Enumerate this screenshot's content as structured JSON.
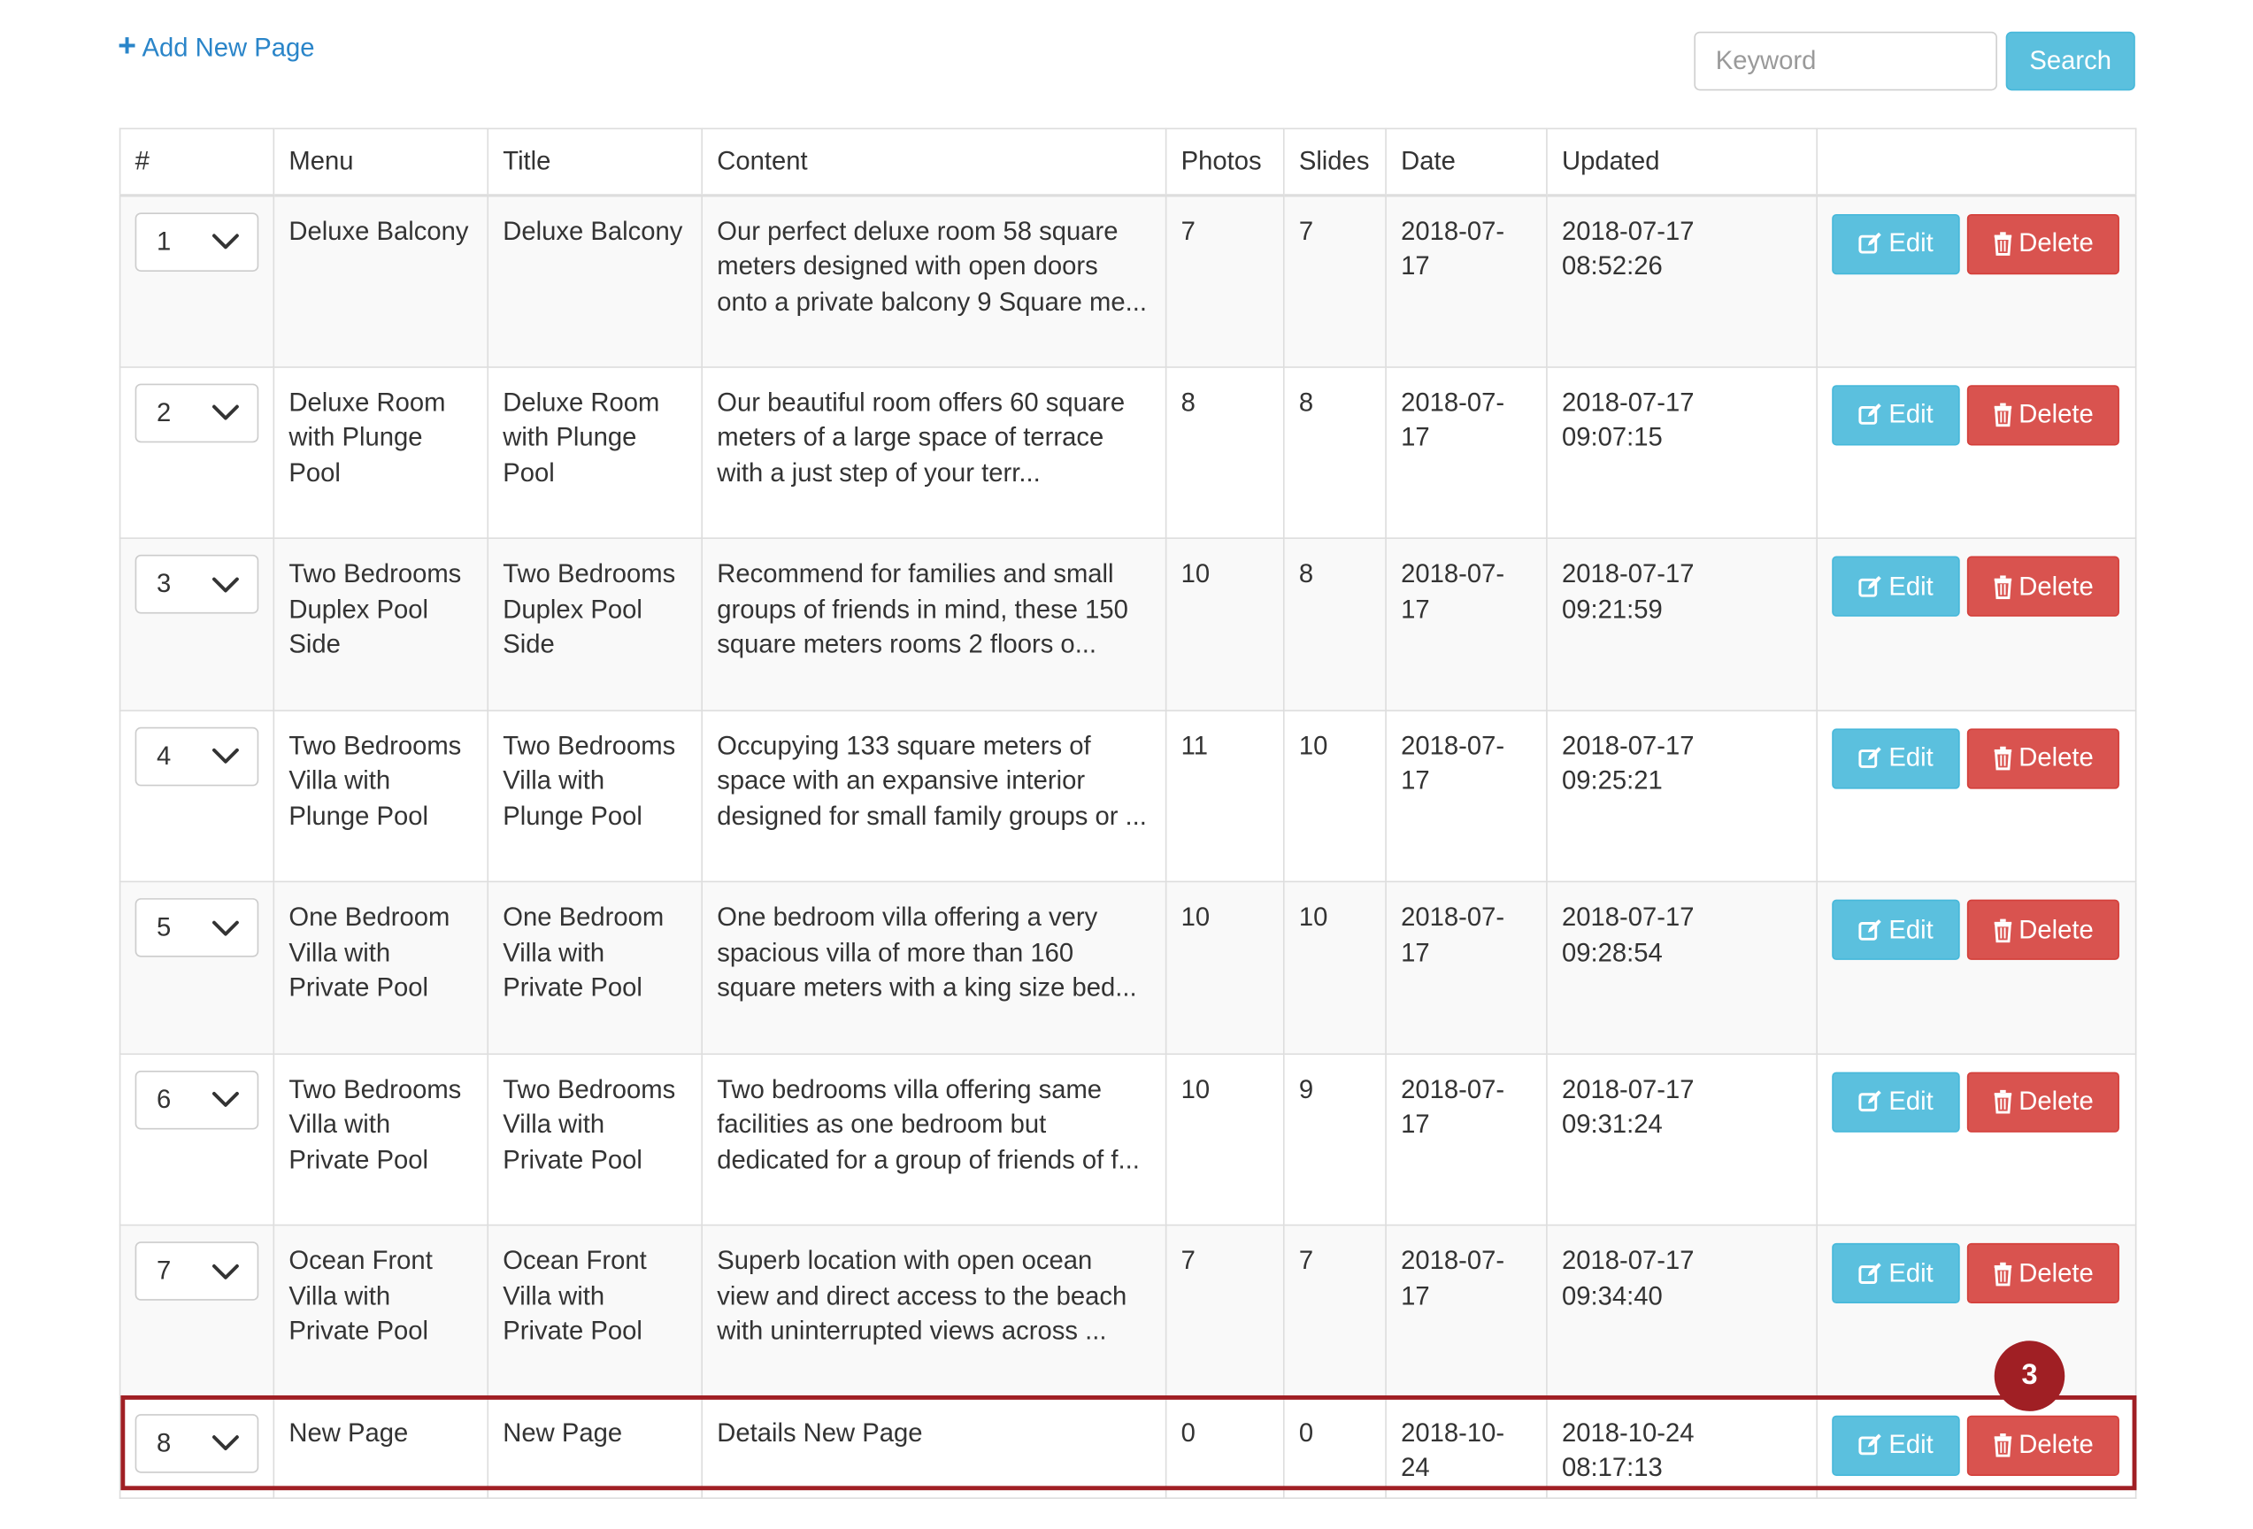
{
  "toolbar": {
    "add_label": "Add New Page",
    "search_placeholder": "Keyword",
    "search_label": "Search"
  },
  "table": {
    "headers": {
      "num": "#",
      "menu": "Menu",
      "title": "Title",
      "content": "Content",
      "photos": "Photos",
      "slides": "Slides",
      "date": "Date",
      "updated": "Updated"
    },
    "edit_label": "Edit",
    "delete_label": "Delete",
    "rows": [
      {
        "order": "1",
        "menu": "Deluxe Balcony",
        "title": "Deluxe Balcony",
        "content": "Our perfect deluxe room 58 square meters designed with open doors onto a private balcony 9 Square me...",
        "photos": "7",
        "slides": "7",
        "date": "2018-07-17",
        "updated": "2018-07-17 08:52:26"
      },
      {
        "order": "2",
        "menu": "Deluxe Room with Plunge Pool",
        "title": "Deluxe Room with Plunge Pool",
        "content": "Our beautiful room offers 60 square meters of a large space of terrace with a just step of your terr...",
        "photos": "8",
        "slides": "8",
        "date": "2018-07-17",
        "updated": "2018-07-17 09:07:15"
      },
      {
        "order": "3",
        "menu": "Two Bedrooms Duplex Pool Side",
        "title": "Two Bedrooms Duplex Pool Side",
        "content": "Recommend for families and small groups of friends in mind, these 150 square meters rooms 2 floors o...",
        "photos": "10",
        "slides": "8",
        "date": "2018-07-17",
        "updated": "2018-07-17 09:21:59"
      },
      {
        "order": "4",
        "menu": "Two Bedrooms Villa with Plunge Pool",
        "title": "Two Bedrooms Villa with Plunge Pool",
        "content": "Occupying 133 square meters of space with an expansive interior designed for small family groups or ...",
        "photos": "11",
        "slides": "10",
        "date": "2018-07-17",
        "updated": "2018-07-17 09:25:21"
      },
      {
        "order": "5",
        "menu": "One Bedroom Villa with Private Pool",
        "title": "One Bedroom Villa with Private Pool",
        "content": "One bedroom villa offering a very spacious villa of more than 160 square meters with a king size bed...",
        "photos": "10",
        "slides": "10",
        "date": "2018-07-17",
        "updated": "2018-07-17 09:28:54"
      },
      {
        "order": "6",
        "menu": "Two Bedrooms Villa with Private Pool",
        "title": "Two Bedrooms Villa with Private Pool",
        "content": "Two bedrooms villa offering same facilities as one bedroom but dedicated for a group of friends of f...",
        "photos": "10",
        "slides": "9",
        "date": "2018-07-17",
        "updated": "2018-07-17 09:31:24"
      },
      {
        "order": "7",
        "menu": "Ocean Front Villa with Private Pool",
        "title": "Ocean Front Villa with Private Pool",
        "content": "Superb location with open ocean view and direct access to the beach with uninterrupted views across ...",
        "photos": "7",
        "slides": "7",
        "date": "2018-07-17",
        "updated": "2018-07-17 09:34:40"
      },
      {
        "order": "8",
        "menu": "New Page",
        "title": "New Page",
        "content": "Details New Page",
        "photos": "0",
        "slides": "0",
        "date": "2018-10-24",
        "updated": "2018-10-24 08:17:13"
      }
    ]
  },
  "annotation": {
    "step": "3",
    "color": "#a01f24"
  },
  "colors": {
    "info": "#5bc0de",
    "danger": "#d9534f",
    "link": "#2a85c9"
  },
  "icons": {
    "add": "plus-icon",
    "edit": "edit-icon",
    "delete": "trash-icon",
    "select": "chevron-down-icon"
  }
}
